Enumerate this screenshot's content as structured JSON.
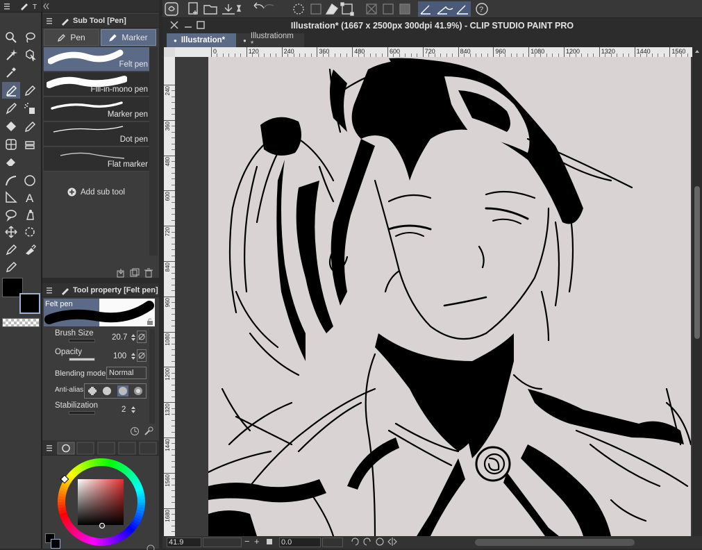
{
  "window": {
    "title": "Illustration* (1667 x 2500px 300dpi 41.9%)  - CLIP STUDIO PAINT PRO"
  },
  "doc_tabs": [
    {
      "label": "Illustration*",
      "active": true
    },
    {
      "label": "Illustrationm *",
      "active": false
    }
  ],
  "toolbar": {
    "icons": [
      "clip-studio-icon",
      "new-icon",
      "open-icon",
      "save-icon",
      "undo-icon",
      "redo-icon",
      "loading-icon",
      "fill-icon",
      "transform-icon",
      "selection-icon",
      "snap-icon",
      "ruler-icon",
      "pen-stabilize-icon",
      "help-icon"
    ]
  },
  "subtool_panel": {
    "title": "Sub Tool [Pen]",
    "tabs": [
      {
        "label": "Pen",
        "active": false
      },
      {
        "label": "Marker",
        "active": true
      }
    ],
    "items": [
      {
        "label": "Felt pen",
        "selected": true
      },
      {
        "label": "Fill-in-mono pen",
        "selected": false
      },
      {
        "label": "Marker pen",
        "selected": false
      },
      {
        "label": "Dot pen",
        "selected": false
      },
      {
        "label": "Flat marker",
        "selected": false
      }
    ],
    "add_label": "Add sub tool"
  },
  "tool_property": {
    "title": "Tool property [Felt pen]",
    "preview_label": "Felt pen",
    "brush_size_label": "Brush Size",
    "brush_size_value": "20.7",
    "opacity_label": "Opacity",
    "opacity_value": "100",
    "blending_label": "Blending mode",
    "blending_value": "Normal",
    "antialias_label": "Anti-alias",
    "stabilization_label": "Stabilization",
    "stabilization_value": "2"
  },
  "ruler_h_ticks": [
    "0",
    "120",
    "240",
    "360",
    "480",
    "600",
    "720",
    "840",
    "960",
    "1080",
    "1200",
    "1320",
    "1440",
    "1560"
  ],
  "ruler_v_ticks": [
    "240",
    "360",
    "480",
    "600",
    "720",
    "840",
    "960",
    "1080",
    "1200",
    "1320",
    "1440",
    "1560",
    "1680"
  ],
  "status": {
    "zoom": "41.9",
    "rotation": "0.0"
  },
  "colors": {
    "main": "#000000",
    "sub": "#000000",
    "accent": "#5b6a86",
    "paper": "#d9d4d3"
  }
}
